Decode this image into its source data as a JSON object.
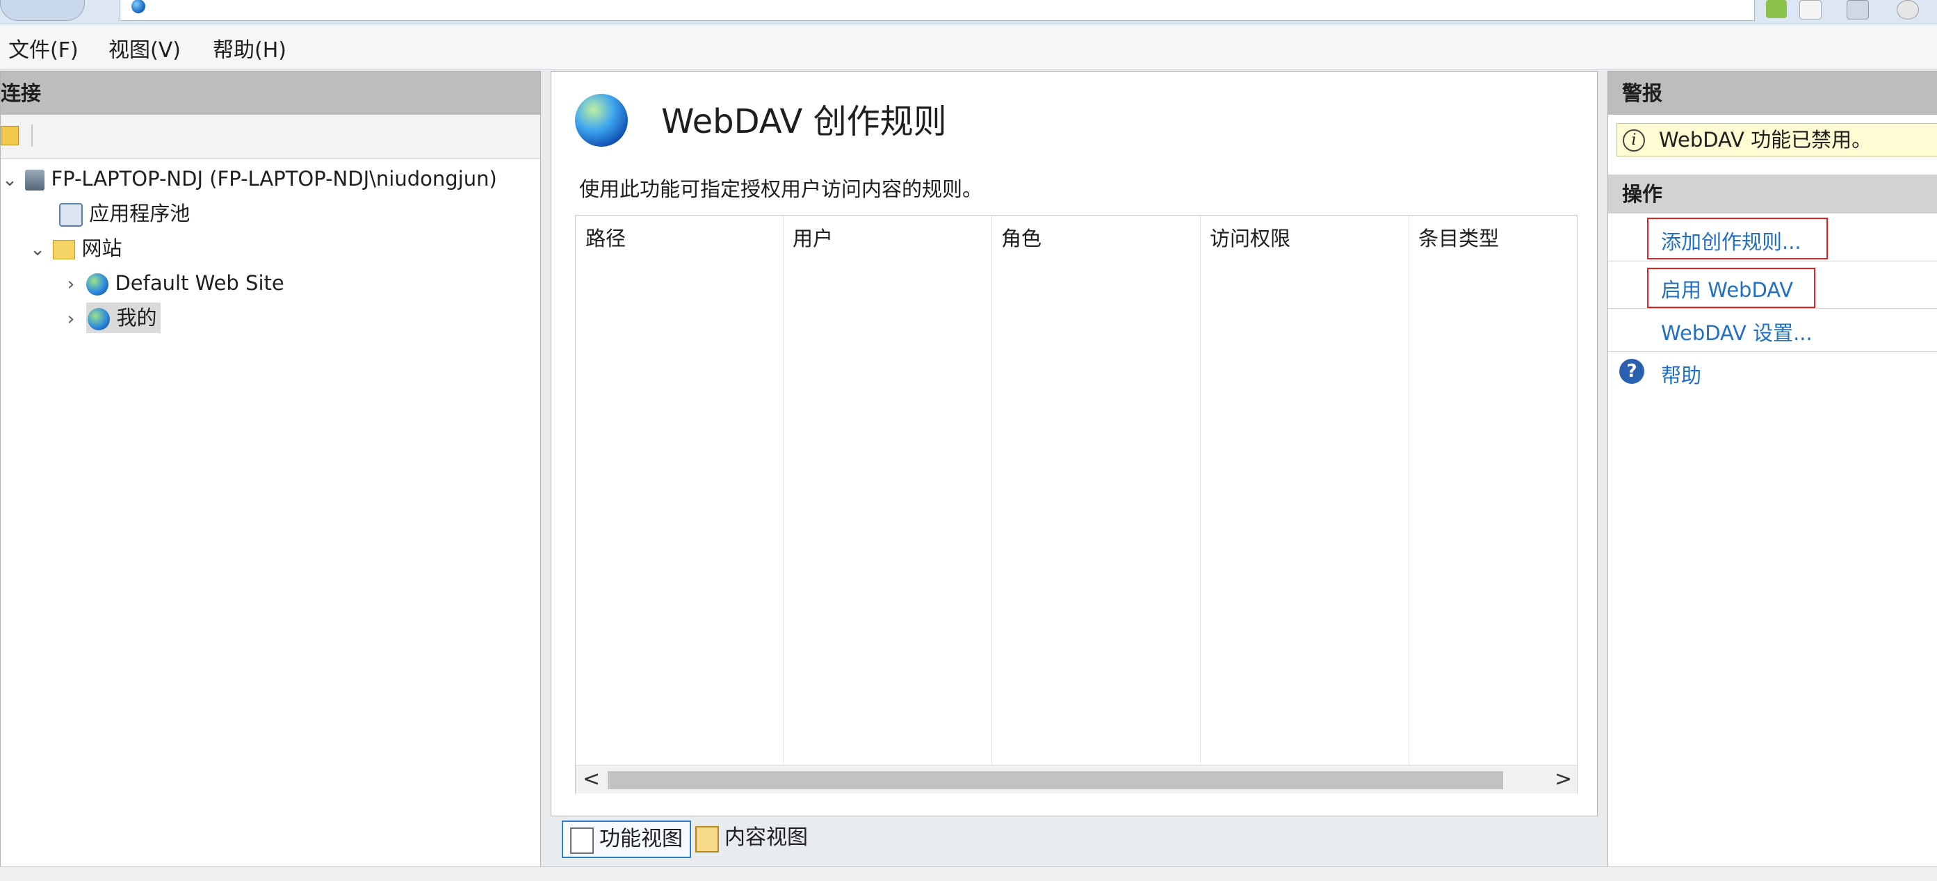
{
  "menu": {
    "file": "文件(F)",
    "view": "视图(V)",
    "help": "帮助(H)"
  },
  "connections": {
    "header": "连接",
    "tree": {
      "server": "FP-LAPTOP-NDJ (FP-LAPTOP-NDJ\\niudongjun)",
      "app_pools": "应用程序池",
      "sites": "网站",
      "default_site": "Default Web Site",
      "my_site": "我的"
    }
  },
  "main": {
    "title": "WebDAV 创作规则",
    "description": "使用此功能可指定授权用户访问内容的规则。",
    "columns": [
      "路径",
      "用户",
      "角色",
      "访问权限",
      "条目类型"
    ],
    "scroll_left": "<",
    "scroll_right": ">"
  },
  "view_tabs": {
    "feature_view": "功能视图",
    "content_view": "内容视图"
  },
  "alerts": {
    "header": "警报",
    "message": "WebDAV 功能已禁用。",
    "icon": "info-icon"
  },
  "actions": {
    "header": "操作",
    "add_rule": "添加创作规则...",
    "enable": "启用 WebDAV",
    "settings": "WebDAV 设置...",
    "help": "帮助"
  },
  "colors": {
    "link": "#1f6fc5",
    "highlight_box": "#e02020",
    "alert_bg": "#fffbd2"
  }
}
